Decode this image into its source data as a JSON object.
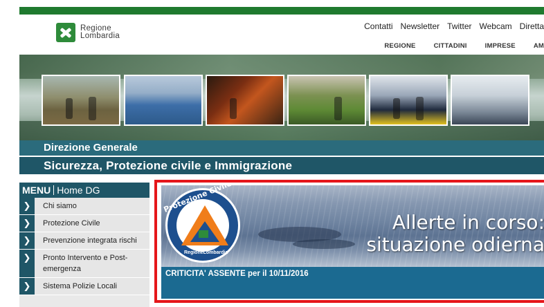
{
  "header": {
    "logo_line1": "Regione",
    "logo_line2": "Lombardia",
    "top_links": [
      "Contatti",
      "Newsletter",
      "Twitter",
      "Webcam",
      "Diretta"
    ],
    "sub_nav": [
      "REGIONE",
      "CITTADINI",
      "IMPRESE",
      "AM"
    ]
  },
  "titles": {
    "direzione": "Direzione Generale",
    "sicurezza": "Sicurezza, Protezione civile e Immigrazione"
  },
  "menu": {
    "title": "MENU",
    "home": "Home DG",
    "items": [
      {
        "label": "Chi siamo"
      },
      {
        "label": "Protezione Civile"
      },
      {
        "label": "Prevenzione integrata rischi"
      },
      {
        "label": "Pronto Intervento e Post-emergenza"
      },
      {
        "label": "Sistema Polizie Locali"
      }
    ],
    "arrow_glyph": "❯"
  },
  "alert": {
    "logo_top": "Protezione Civile",
    "logo_bottom": "RegioneLombardia",
    "line1": "Allerte in corso:",
    "line2": "situazione odierna",
    "status": "CRITICITA' ASSENTE per il 10/11/2016",
    "border_color": "#e5161a"
  },
  "colors": {
    "brand_green": "#1f7a2f",
    "teal_dark": "#1f5667",
    "teal": "#2b6b7c",
    "status_blue": "#1b6a91"
  }
}
